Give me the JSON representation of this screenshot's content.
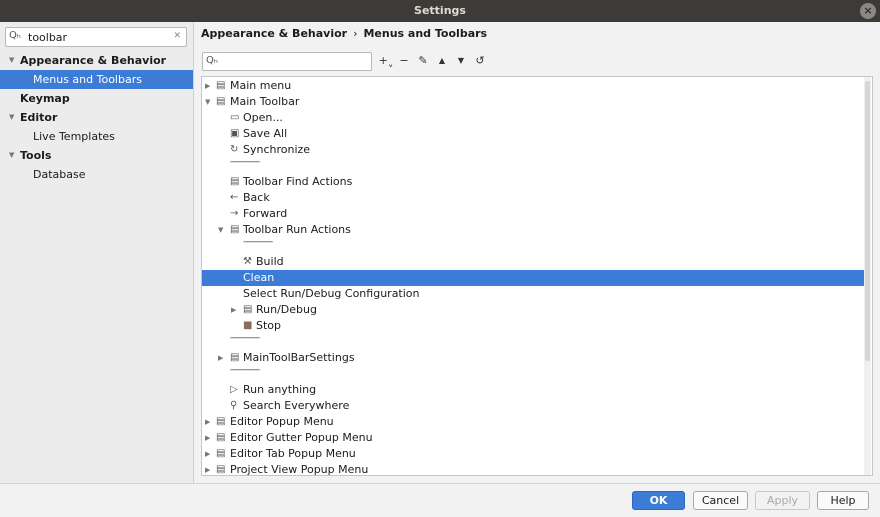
{
  "window": {
    "title": "Settings",
    "close_glyph": "×"
  },
  "left": {
    "search": {
      "value": "toolbar",
      "icon": "Qₕ",
      "clear": "✕"
    },
    "items": [
      {
        "label": "Appearance & Behavior",
        "arrow": "▼"
      },
      {
        "label": "Menus and Toolbars"
      },
      {
        "label": "Keymap"
      },
      {
        "label": "Editor",
        "arrow": "▼"
      },
      {
        "label": "Live Templates"
      },
      {
        "label": "Tools",
        "arrow": "▼"
      },
      {
        "label": "Database"
      }
    ]
  },
  "breadcrumb": {
    "part1": "Appearance & Behavior",
    "sep": "›",
    "part2": "Menus and Toolbars"
  },
  "toolbar": {
    "filter_icon": "Qₕ",
    "add": "+ˬ",
    "remove": "−",
    "edit": "✎",
    "up": "▲",
    "down": "▼",
    "restore": "↺"
  },
  "tree": {
    "rows": [
      {
        "label": "Main menu",
        "twisty": "▶",
        "icon": "▤"
      },
      {
        "label": "Main Toolbar",
        "twisty": "▼",
        "icon": "▤"
      },
      {
        "label": "Open...",
        "icon": "▭"
      },
      {
        "label": "Save All",
        "icon": "▣"
      },
      {
        "label": "Synchronize",
        "icon": "↻"
      },
      {
        "label": "-------------"
      },
      {
        "label": "Toolbar Find Actions",
        "icon": "▤"
      },
      {
        "label": "Back",
        "icon": "←"
      },
      {
        "label": "Forward",
        "icon": "→"
      },
      {
        "label": "Toolbar Run Actions",
        "twisty": "▼",
        "icon": "▤"
      },
      {
        "label": "-------------"
      },
      {
        "label": "Build",
        "icon": "⚒"
      },
      {
        "label": "Clean"
      },
      {
        "label": "Select Run/Debug Configuration"
      },
      {
        "label": "Run/Debug",
        "twisty": "▶",
        "icon": "▤"
      },
      {
        "label": "Stop",
        "icon": "■"
      },
      {
        "label": "-------------"
      },
      {
        "label": "MainToolBarSettings",
        "twisty": "▶",
        "icon": "▤"
      },
      {
        "label": "-------------"
      },
      {
        "label": "Run anything",
        "icon": "▷"
      },
      {
        "label": "Search Everywhere",
        "icon": "⚲"
      },
      {
        "label": "Editor Popup Menu",
        "twisty": "▶",
        "icon": "▤"
      },
      {
        "label": "Editor Gutter Popup Menu",
        "twisty": "▶",
        "icon": "▤"
      },
      {
        "label": "Editor Tab Popup Menu",
        "twisty": "▶",
        "icon": "▤"
      },
      {
        "label": "Project View Popup Menu",
        "twisty": "▶",
        "icon": "▤"
      }
    ]
  },
  "buttons": {
    "ok": "OK",
    "cancel": "Cancel",
    "apply": "Apply",
    "help": "Help"
  },
  "colors": {
    "accent": "#3c7bd6",
    "titlebar": "#3c3b37"
  }
}
